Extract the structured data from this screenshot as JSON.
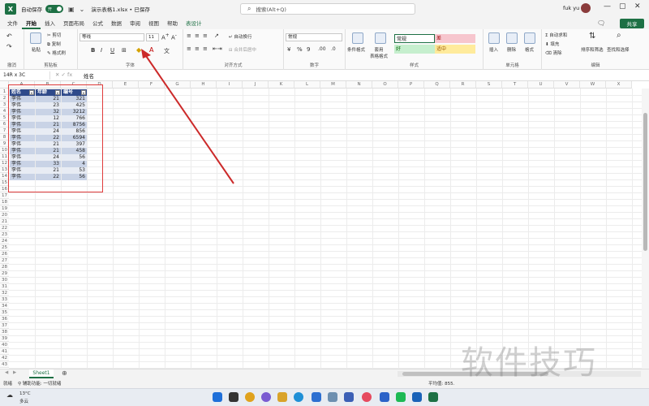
{
  "titlebar": {
    "autosave_label": "自动保存",
    "autosave_toggle": "开",
    "doc_title": "演示表格1.xlsx • 已保存",
    "search_placeholder": "搜索(Alt+Q)",
    "user": "fuk yu"
  },
  "menu": {
    "tabs": [
      "文件",
      "开始",
      "插入",
      "页面布局",
      "公式",
      "数据",
      "审阅",
      "视图",
      "帮助",
      "表设计"
    ],
    "active": "开始",
    "share": "共享"
  },
  "ribbon": {
    "clipboard": {
      "label": "剪贴板",
      "paste": "粘贴",
      "cut": "剪切",
      "copy": "复制",
      "format_painter": "格式刷"
    },
    "undo_label": "撤消",
    "font": {
      "label": "字体",
      "name": "等线",
      "size": "11"
    },
    "alignment": {
      "label": "对齐方式",
      "wrap": "自动换行",
      "merge": "合并后居中"
    },
    "number": {
      "label": "数字",
      "format": "常规"
    },
    "styles": {
      "label": "样式",
      "conditional": "条件格式",
      "table_format": "套用\n表格格式",
      "normal": "常规",
      "bad": "差",
      "good": "好",
      "neutral": "适中"
    },
    "cells": {
      "label": "单元格",
      "insert": "插入",
      "delete": "删除",
      "format": "格式"
    },
    "editing": {
      "label": "编辑",
      "autosum": "自动求和",
      "fill": "填充",
      "clear": "清除",
      "sort": "排序和筛选",
      "find": "查找和选择"
    }
  },
  "formula_bar": {
    "name_box": "14R x 3C",
    "fx": "fx",
    "content": "姓名"
  },
  "columns": [
    "A",
    "B",
    "C",
    "D",
    "E",
    "F",
    "G",
    "H",
    "I",
    "J",
    "K",
    "L",
    "M",
    "N",
    "O",
    "P",
    "Q",
    "R",
    "S",
    "T",
    "U",
    "V",
    "W",
    "X"
  ],
  "table": {
    "headers": [
      "姓名",
      "年龄",
      "编号"
    ],
    "rows": [
      [
        "李伟",
        "21",
        "321"
      ],
      [
        "李伟",
        "23",
        "425"
      ],
      [
        "李伟",
        "32",
        "3212"
      ],
      [
        "李伟",
        "12",
        "766"
      ],
      [
        "李伟",
        "21",
        "8756"
      ],
      [
        "李伟",
        "24",
        "856"
      ],
      [
        "李伟",
        "22",
        "6594"
      ],
      [
        "李伟",
        "21",
        "397"
      ],
      [
        "李伟",
        "21",
        "458"
      ],
      [
        "李伟",
        "24",
        "56"
      ],
      [
        "李伟",
        "33",
        "4"
      ],
      [
        "李伟",
        "21",
        "53"
      ],
      [
        "李伟",
        "22",
        "56"
      ]
    ]
  },
  "sheet_tab": "Sheet1",
  "status": {
    "ready": "就绪",
    "accessibility": "辅助功能: 一切就绪",
    "average": "平均值: 855."
  },
  "taskbar": {
    "weather_temp": "13°C",
    "weather_desc": "多云"
  },
  "watermark": "软件技巧",
  "colors": {
    "excel_green": "#1d7044",
    "table_header": "#2f4a8a",
    "row_odd": "#c9d3e6",
    "row_even": "#e8ecf4",
    "highlight_box": "#e03c3c",
    "arrow": "#cc2a2a"
  }
}
